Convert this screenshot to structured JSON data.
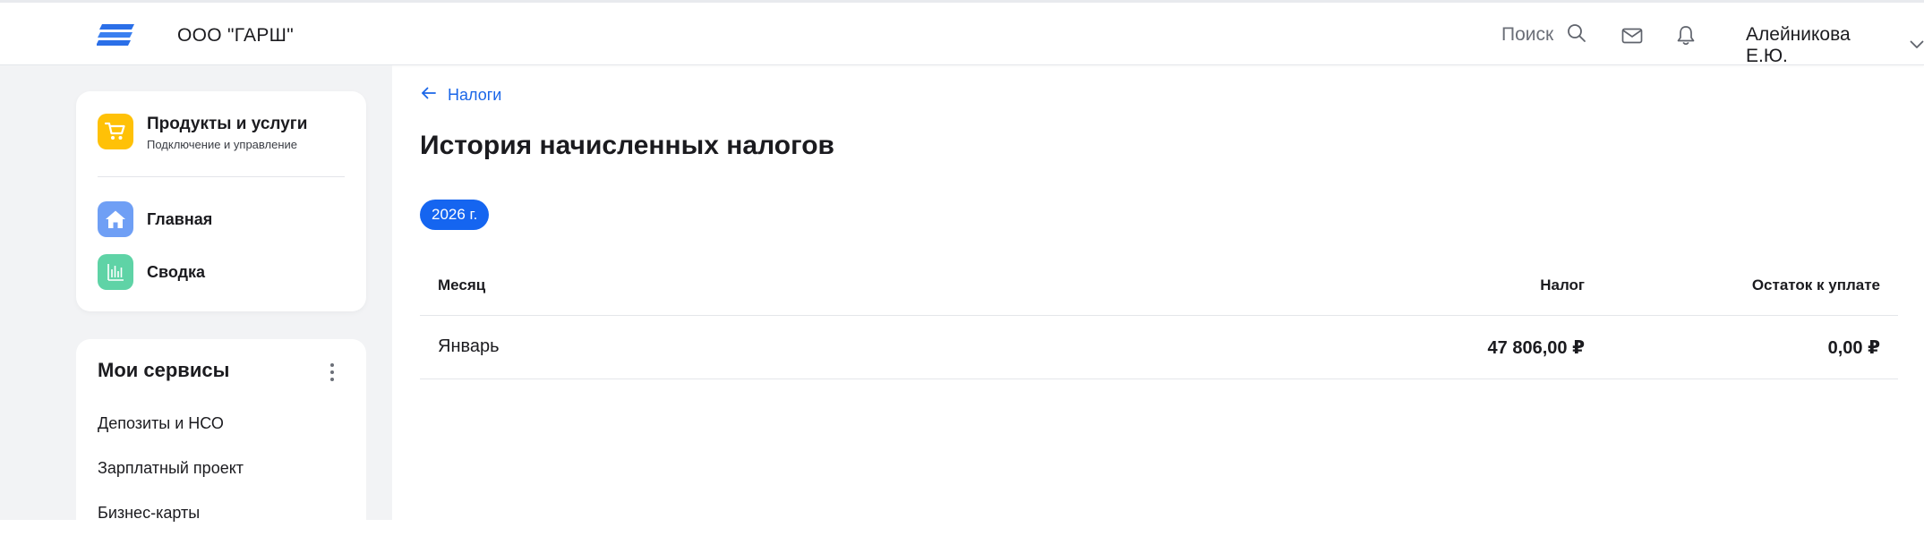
{
  "header": {
    "company": "ООО \"ГАРШ\"",
    "search_label": "Поиск",
    "user_name": "Алейникова Е.Ю."
  },
  "sidebar": {
    "products": {
      "title": "Продукты и услуги",
      "subtitle": "Подключение и управление"
    },
    "nav": [
      {
        "label": "Главная",
        "icon": "home-icon",
        "color": "#6f9ff5"
      },
      {
        "label": "Сводка",
        "icon": "chart-icon",
        "color": "#5fd3a6"
      }
    ],
    "services": {
      "title": "Мои сервисы",
      "items": [
        "Депозиты и НСО",
        "Зарплатный проект",
        "Бизнес-карты"
      ]
    }
  },
  "main": {
    "back_label": "Налоги",
    "title": "История начисленных налогов",
    "year_chip": "2026 г.",
    "table": {
      "columns": [
        "Месяц",
        "Налог",
        "Остаток к уплате"
      ],
      "rows": [
        {
          "month": "Январь",
          "tax": "47 806,00 ₽",
          "remaining": "0,00 ₽"
        }
      ]
    }
  },
  "colors": {
    "accent": "#1565f0",
    "link": "#1a66e8",
    "products_icon": "#ffc107",
    "sidebar_bg": "#f2f3f5"
  }
}
